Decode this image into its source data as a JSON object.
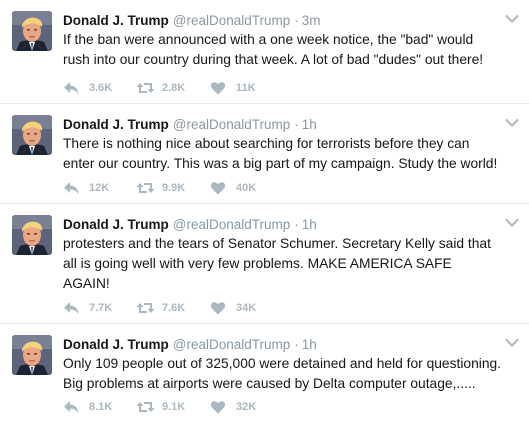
{
  "colors": {
    "name": "#14171a",
    "secondary": "#8899a6",
    "action": "#aab8c2",
    "divider": "#e6ecf0"
  },
  "icons": {
    "reply": "reply-arrow-icon",
    "retweet": "retweet-icon",
    "like": "heart-icon",
    "menu": "chevron-down-icon"
  },
  "tweets": [
    {
      "name": "Donald J. Trump",
      "handle": "@realDonaldTrump",
      "dot": "·",
      "time": "3m",
      "lines": [
        "If the ban were announced with a one week notice, the \"bad\" would",
        "rush into our country during that week. A lot of bad \"dudes\" out there!"
      ],
      "replies": "3.6K",
      "retweets": "2.8K",
      "likes": "11K"
    },
    {
      "name": "Donald J. Trump",
      "handle": "@realDonaldTrump",
      "dot": "·",
      "time": "1h",
      "lines": [
        "There is nothing nice about searching for terrorists before they can",
        "enter our country. This was a big part of my campaign. Study the world!"
      ],
      "replies": "12K",
      "retweets": "9.9K",
      "likes": "40K"
    },
    {
      "name": "Donald J. Trump",
      "handle": "@realDonaldTrump",
      "dot": "·",
      "time": "1h",
      "lines": [
        "protesters and the tears of Senator Schumer. Secretary Kelly said that",
        "all is going well with very few problems. MAKE AMERICA SAFE",
        "AGAIN!"
      ],
      "replies": "7.7K",
      "retweets": "7.6K",
      "likes": "34K"
    },
    {
      "name": "Donald J. Trump",
      "handle": "@realDonaldTrump",
      "dot": "·",
      "time": "1h",
      "lines": [
        "Only 109 people out of 325,000 were detained and held for questioning.",
        "Big problems at airports were caused by Delta computer outage,....."
      ],
      "replies": "8.1K",
      "retweets": "9.1K",
      "likes": "32K"
    }
  ]
}
